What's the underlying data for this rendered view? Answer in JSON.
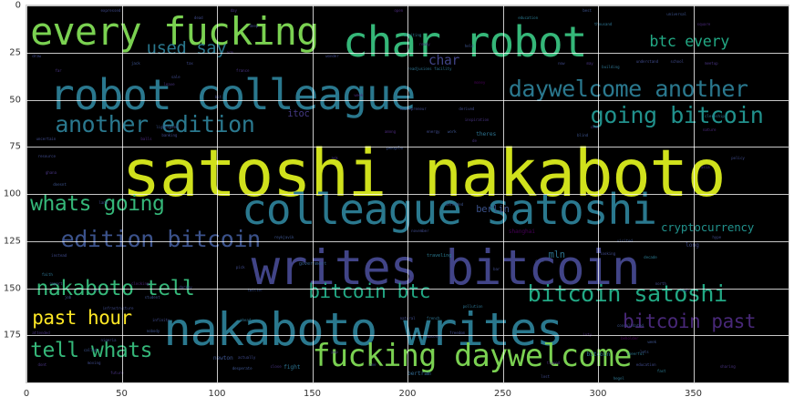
{
  "chart_data": {
    "type": "wordcloud",
    "xlim": [
      0,
      400
    ],
    "ylim": [
      200,
      0
    ],
    "xticks": [
      0,
      50,
      100,
      150,
      200,
      250,
      300,
      350
    ],
    "yticks": [
      0,
      25,
      50,
      75,
      100,
      125,
      150,
      175
    ],
    "grid": true,
    "words": [
      {
        "text": "satoshi nakaboto",
        "x": 50,
        "y": 72,
        "size": 34,
        "color": "#d0e11c"
      },
      {
        "text": "writes bitcoin",
        "x": 118,
        "y": 127,
        "size": 25,
        "color": "#414487"
      },
      {
        "text": "nakaboto writes",
        "x": 72,
        "y": 160,
        "size": 24,
        "color": "#2a788e"
      },
      {
        "text": "colleague satoshi",
        "x": 113,
        "y": 97,
        "size": 22,
        "color": "#2a788e"
      },
      {
        "text": "robot colleague",
        "x": 12,
        "y": 36,
        "size": 22,
        "color": "#2a788e"
      },
      {
        "text": "char robot",
        "x": 166,
        "y": 8,
        "size": 22,
        "color": "#35b779"
      },
      {
        "text": "every fucking",
        "x": 2,
        "y": 4,
        "size": 20,
        "color": "#7ad151"
      },
      {
        "text": "fucking daywelcome",
        "x": 150,
        "y": 178,
        "size": 16,
        "color": "#7ad151"
      },
      {
        "text": "going bitcoin",
        "x": 296,
        "y": 52,
        "size": 12,
        "color": "#21918c"
      },
      {
        "text": "daywelcome another",
        "x": 253,
        "y": 38,
        "size": 12,
        "color": "#2a788e"
      },
      {
        "text": "another edition",
        "x": 15,
        "y": 57,
        "size": 12,
        "color": "#2a788e"
      },
      {
        "text": "edition bitcoin",
        "x": 18,
        "y": 118,
        "size": 12,
        "color": "#3b528b"
      },
      {
        "text": "bitcoin satoshi",
        "x": 263,
        "y": 147,
        "size": 12,
        "color": "#22a884"
      },
      {
        "text": "bitcoin btc",
        "x": 148,
        "y": 147,
        "size": 10,
        "color": "#22a884"
      },
      {
        "text": "nakaboto tell",
        "x": 5,
        "y": 145,
        "size": 11,
        "color": "#35b779"
      },
      {
        "text": "whats going",
        "x": 2,
        "y": 100,
        "size": 11,
        "color": "#35b779"
      },
      {
        "text": "tell whats",
        "x": 2,
        "y": 178,
        "size": 11,
        "color": "#35b779"
      },
      {
        "text": "bitcoin past",
        "x": 313,
        "y": 163,
        "size": 10,
        "color": "#482878"
      },
      {
        "text": "past hour",
        "x": 3,
        "y": 161,
        "size": 10,
        "color": "#fde725"
      },
      {
        "text": "btc every",
        "x": 327,
        "y": 15,
        "size": 8,
        "color": "#22a884"
      },
      {
        "text": "used say",
        "x": 63,
        "y": 19,
        "size": 9,
        "color": "#2a788e"
      },
      {
        "text": "cryptocurrency",
        "x": 333,
        "y": 115,
        "size": 6,
        "color": "#21918c"
      },
      {
        "text": "char",
        "x": 211,
        "y": 26,
        "size": 7,
        "color": "#414487"
      },
      {
        "text": "itoc",
        "x": 137,
        "y": 55,
        "size": 5,
        "color": "#443983"
      },
      {
        "text": "berlin",
        "x": 236,
        "y": 106,
        "size": 5,
        "color": "#3b528b"
      },
      {
        "text": "mln",
        "x": 274,
        "y": 130,
        "size": 5,
        "color": "#2c728e"
      },
      {
        "text": "theres",
        "x": 236,
        "y": 67,
        "size": 3,
        "color": "#2c728e"
      },
      {
        "text": "inspiration",
        "x": 230,
        "y": 60,
        "size": 2,
        "color": "#46327e"
      },
      {
        "text": "bitcoin",
        "x": 294,
        "y": 184,
        "size": 3,
        "color": "#2c728e"
      },
      {
        "text": "shanghai",
        "x": 253,
        "y": 119,
        "size": 3,
        "color": "#440154"
      },
      {
        "text": "people",
        "x": 189,
        "y": 75,
        "size": 2.5,
        "color": "#3b528b"
      },
      {
        "text": "government",
        "x": 143,
        "y": 136,
        "size": 2.5,
        "color": "#355f8d"
      },
      {
        "text": "traveling",
        "x": 210,
        "y": 132,
        "size": 2.5,
        "color": "#2a788e"
      },
      {
        "text": "clocking",
        "x": 55,
        "y": 147,
        "size": 2,
        "color": "#482475"
      },
      {
        "text": "newton",
        "x": 98,
        "y": 186,
        "size": 3,
        "color": "#3b528b"
      },
      {
        "text": "actually",
        "x": 111,
        "y": 186,
        "size": 2,
        "color": "#3e4989"
      },
      {
        "text": "fight",
        "x": 135,
        "y": 191,
        "size": 3,
        "color": "#2c728e"
      },
      {
        "text": "desperate",
        "x": 108,
        "y": 192,
        "size": 2,
        "color": "#3b528b"
      },
      {
        "text": "close",
        "x": 128,
        "y": 191,
        "size": 2,
        "color": "#46327e"
      },
      {
        "text": "bertram",
        "x": 200,
        "y": 194,
        "size": 3,
        "color": "#31688e"
      },
      {
        "text": "hegel",
        "x": 308,
        "y": 197,
        "size": 2,
        "color": "#2c728e"
      },
      {
        "text": "sharing",
        "x": 364,
        "y": 191,
        "size": 2,
        "color": "#46327e"
      },
      {
        "text": "education",
        "x": 320,
        "y": 190,
        "size": 2,
        "color": "#3e4989"
      },
      {
        "text": "fast",
        "x": 331,
        "y": 193,
        "size": 2,
        "color": "#2a788e"
      },
      {
        "text": "tipped",
        "x": 273,
        "y": 189,
        "size": 2,
        "color": "#482878"
      },
      {
        "text": "ioty",
        "x": 292,
        "y": 174,
        "size": 2,
        "color": "#482878"
      },
      {
        "text": "week",
        "x": 326,
        "y": 178,
        "size": 2,
        "color": "#3b528b"
      },
      {
        "text": "beholder",
        "x": 312,
        "y": 176,
        "size": 2,
        "color": "#440154"
      },
      {
        "text": "cheerful",
        "x": 315,
        "y": 184,
        "size": 2,
        "color": "#2a788e"
      },
      {
        "text": "consolidated",
        "x": 310,
        "y": 169,
        "size": 2,
        "color": "#3b528b"
      },
      {
        "text": "expressed",
        "x": 39,
        "y": 2,
        "size": 2,
        "color": "#3e4989"
      },
      {
        "text": "dead",
        "x": 88,
        "y": 6,
        "size": 2,
        "color": "#3e4989"
      },
      {
        "text": "day",
        "x": 107,
        "y": 2,
        "size": 2,
        "color": "#46327e"
      },
      {
        "text": "deep",
        "x": 117,
        "y": 10,
        "size": 2,
        "color": "#3e4989"
      },
      {
        "text": "open",
        "x": 193,
        "y": 2,
        "size": 2,
        "color": "#482878"
      },
      {
        "text": "education",
        "x": 258,
        "y": 6,
        "size": 2,
        "color": "#2a788e"
      },
      {
        "text": "best",
        "x": 292,
        "y": 2,
        "size": 2,
        "color": "#3b528b"
      },
      {
        "text": "universal",
        "x": 336,
        "y": 4,
        "size": 2,
        "color": "#3b528b"
      },
      {
        "text": "thousand",
        "x": 298,
        "y": 9,
        "size": 2,
        "color": "#2c728e"
      },
      {
        "text": "square",
        "x": 352,
        "y": 9,
        "size": 2,
        "color": "#482878"
      },
      {
        "text": "ready",
        "x": 206,
        "y": 20,
        "size": 2,
        "color": "#482878"
      },
      {
        "text": "held",
        "x": 230,
        "y": 21,
        "size": 2,
        "color": "#3b528b"
      },
      {
        "text": "inviting",
        "x": 198,
        "y": 15,
        "size": 2,
        "color": "#2a788e"
      },
      {
        "text": "readjusions facility",
        "x": 200,
        "y": 33,
        "size": 2,
        "color": "#2c728e"
      },
      {
        "text": "money",
        "x": 235,
        "y": 40,
        "size": 2,
        "color": "#440154"
      },
      {
        "text": "building",
        "x": 302,
        "y": 32,
        "size": 2,
        "color": "#2c728e"
      },
      {
        "text": "understand",
        "x": 320,
        "y": 29,
        "size": 2,
        "color": "#3e4989"
      },
      {
        "text": "school",
        "x": 338,
        "y": 29,
        "size": 2,
        "color": "#3e4989"
      },
      {
        "text": "meetup",
        "x": 356,
        "y": 30,
        "size": 2,
        "color": "#46327e"
      },
      {
        "text": "entrepreneur",
        "x": 196,
        "y": 54,
        "size": 2,
        "color": "#3e4989"
      },
      {
        "text": "derived",
        "x": 227,
        "y": 54,
        "size": 2,
        "color": "#3e4989"
      },
      {
        "text": "energy",
        "x": 210,
        "y": 66,
        "size": 2,
        "color": "#3e4989"
      },
      {
        "text": "work",
        "x": 221,
        "y": 66,
        "size": 2,
        "color": "#3b528b"
      },
      {
        "text": "among",
        "x": 188,
        "y": 66,
        "size": 2,
        "color": "#482878"
      },
      {
        "text": "blind",
        "x": 289,
        "y": 68,
        "size": 2,
        "color": "#3b528b"
      },
      {
        "text": "char",
        "x": 296,
        "y": 64,
        "size": 2,
        "color": "#46327e"
      },
      {
        "text": "clerkship",
        "x": 356,
        "y": 58,
        "size": 2,
        "color": "#2c728e"
      },
      {
        "text": "nature",
        "x": 355,
        "y": 65,
        "size": 2,
        "color": "#482878"
      },
      {
        "text": "sale",
        "x": 76,
        "y": 37,
        "size": 2,
        "color": "#3e4989"
      },
      {
        "text": "jack",
        "x": 55,
        "y": 30,
        "size": 2,
        "color": "#3b528b"
      },
      {
        "text": "leave",
        "x": 72,
        "y": 41,
        "size": 2,
        "color": "#46327e"
      },
      {
        "text": "banking",
        "x": 71,
        "y": 68,
        "size": 2,
        "color": "#3e4989"
      },
      {
        "text": "lightspeed",
        "x": 68,
        "y": 64,
        "size": 2,
        "color": "#3b528b"
      },
      {
        "text": "balls",
        "x": 60,
        "y": 70,
        "size": 2,
        "color": "#482878"
      },
      {
        "text": "uncertain",
        "x": 5,
        "y": 70,
        "size": 2,
        "color": "#3e4989"
      },
      {
        "text": "resource",
        "x": 6,
        "y": 79,
        "size": 2,
        "color": "#3e4989"
      },
      {
        "text": "ghana",
        "x": 10,
        "y": 88,
        "size": 2,
        "color": "#46327e"
      },
      {
        "text": "doesnt",
        "x": 14,
        "y": 94,
        "size": 2,
        "color": "#3b528b"
      },
      {
        "text": "instead",
        "x": 13,
        "y": 132,
        "size": 2,
        "color": "#3e4989"
      },
      {
        "text": "reykjavik",
        "x": 130,
        "y": 122,
        "size": 2,
        "color": "#3b528b"
      },
      {
        "text": "november",
        "x": 202,
        "y": 119,
        "size": 2,
        "color": "#3e4989"
      },
      {
        "text": "visited",
        "x": 310,
        "y": 124,
        "size": 2,
        "color": "#3b528b"
      },
      {
        "text": "hype",
        "x": 360,
        "y": 122,
        "size": 2,
        "color": "#3e4989"
      },
      {
        "text": "looking",
        "x": 301,
        "y": 131,
        "size": 2,
        "color": "#3e4989"
      },
      {
        "text": "decade",
        "x": 324,
        "y": 133,
        "size": 2,
        "color": "#2a788e"
      },
      {
        "text": "long",
        "x": 346,
        "y": 126,
        "size": 3,
        "color": "#3e4989"
      },
      {
        "text": "north",
        "x": 330,
        "y": 147,
        "size": 2,
        "color": "#3e4989"
      },
      {
        "text": "high",
        "x": 343,
        "y": 150,
        "size": 2,
        "color": "#3e4989"
      },
      {
        "text": "student",
        "x": 62,
        "y": 154,
        "size": 2,
        "color": "#3b528b"
      },
      {
        "text": "report",
        "x": 12,
        "y": 147,
        "size": 2,
        "color": "#3e4989"
      },
      {
        "text": "faith",
        "x": 8,
        "y": 142,
        "size": 2,
        "color": "#2c728e"
      },
      {
        "text": "twitter",
        "x": 116,
        "y": 150,
        "size": 2,
        "color": "#3b528b"
      },
      {
        "text": "darkey",
        "x": 80,
        "y": 149,
        "size": 2,
        "color": "#3e4989"
      },
      {
        "text": "natural",
        "x": 196,
        "y": 165,
        "size": 2,
        "color": "#3e4989"
      },
      {
        "text": "pollution",
        "x": 229,
        "y": 159,
        "size": 2,
        "color": "#2c728e"
      },
      {
        "text": "french",
        "x": 210,
        "y": 165,
        "size": 2,
        "color": "#2c728e"
      },
      {
        "text": "infinity",
        "x": 66,
        "y": 166,
        "size": 2,
        "color": "#3e4989"
      },
      {
        "text": "nigeria",
        "x": 39,
        "y": 177,
        "size": 2,
        "color": "#3e4989"
      },
      {
        "text": "nobody",
        "x": 63,
        "y": 172,
        "size": 2,
        "color": "#3b528b"
      },
      {
        "text": "called",
        "x": 30,
        "y": 182,
        "size": 2,
        "color": "#3b528b"
      },
      {
        "text": "attended",
        "x": 3,
        "y": 173,
        "size": 2,
        "color": "#46327e"
      },
      {
        "text": "moving",
        "x": 32,
        "y": 189,
        "size": 2,
        "color": "#3e4989"
      },
      {
        "text": "future",
        "x": 44,
        "y": 194,
        "size": 2,
        "color": "#46327e"
      },
      {
        "text": "infrastructure",
        "x": 40,
        "y": 160,
        "size": 2,
        "color": "#3e4989"
      },
      {
        "text": "masonry",
        "x": 210,
        "y": 175,
        "size": 2,
        "color": "#3e4989"
      },
      {
        "text": "freedom",
        "x": 222,
        "y": 173,
        "size": 2,
        "color": "#3e4989"
      },
      {
        "text": "defended",
        "x": 220,
        "y": 105,
        "size": 2,
        "color": "#3b528b"
      },
      {
        "text": "policy",
        "x": 370,
        "y": 80,
        "size": 2,
        "color": "#3e4989"
      },
      {
        "text": "asia",
        "x": 354,
        "y": 85,
        "size": 2,
        "color": "#46327e"
      },
      {
        "text": "ahead",
        "x": 112,
        "y": 166,
        "size": 2,
        "color": "#2c728e"
      },
      {
        "text": "draw",
        "x": 3,
        "y": 26,
        "size": 2,
        "color": "#3e4989"
      },
      {
        "text": "arm",
        "x": 105,
        "y": 24,
        "size": 2,
        "color": "#46327e"
      },
      {
        "text": "tax",
        "x": 84,
        "y": 30,
        "size": 2,
        "color": "#3e4989"
      },
      {
        "text": "wonder",
        "x": 157,
        "y": 26,
        "size": 2,
        "color": "#3e4989"
      },
      {
        "text": "france",
        "x": 110,
        "y": 34,
        "size": 2,
        "color": "#46327e"
      },
      {
        "text": "week",
        "x": 172,
        "y": 47,
        "size": 2,
        "color": "#482878"
      },
      {
        "text": "now",
        "x": 279,
        "y": 30,
        "size": 2,
        "color": "#3e4989"
      },
      {
        "text": "may",
        "x": 294,
        "y": 30,
        "size": 2,
        "color": "#46327e"
      },
      {
        "text": "ask",
        "x": 160,
        "y": 80,
        "size": 2,
        "color": "#46327e"
      },
      {
        "text": "de",
        "x": 234,
        "y": 71,
        "size": 2,
        "color": "#46327e"
      },
      {
        "text": "one",
        "x": 180,
        "y": 190,
        "size": 2,
        "color": "#3b528b"
      },
      {
        "text": "dont",
        "x": 6,
        "y": 190,
        "size": 2,
        "color": "#46327e"
      },
      {
        "text": "lost",
        "x": 270,
        "y": 196,
        "size": 2,
        "color": "#3e4989"
      },
      {
        "text": "pop",
        "x": 160,
        "y": 183,
        "size": 2,
        "color": "#46327e"
      },
      {
        "text": "lets",
        "x": 322,
        "y": 183,
        "size": 2,
        "color": "#3b528b"
      },
      {
        "text": "care",
        "x": 267,
        "y": 135,
        "size": 2,
        "color": "#3e4989"
      },
      {
        "text": "bar",
        "x": 245,
        "y": 139,
        "size": 2,
        "color": "#3e4989"
      },
      {
        "text": "lot",
        "x": 200,
        "y": 144,
        "size": 2,
        "color": "#46327e"
      },
      {
        "text": "pick",
        "x": 110,
        "y": 138,
        "size": 2,
        "color": "#3e4989"
      },
      {
        "text": "land",
        "x": 38,
        "y": 104,
        "size": 2,
        "color": "#3e4989"
      },
      {
        "text": "rest",
        "x": 34,
        "y": 150,
        "size": 2,
        "color": "#3e4989"
      },
      {
        "text": "job",
        "x": 20,
        "y": 154,
        "size": 2,
        "color": "#3b528b"
      },
      {
        "text": "bit",
        "x": 99,
        "y": 48,
        "size": 2,
        "color": "#3e4989"
      },
      {
        "text": "far",
        "x": 15,
        "y": 34,
        "size": 2,
        "color": "#46327e"
      }
    ]
  }
}
